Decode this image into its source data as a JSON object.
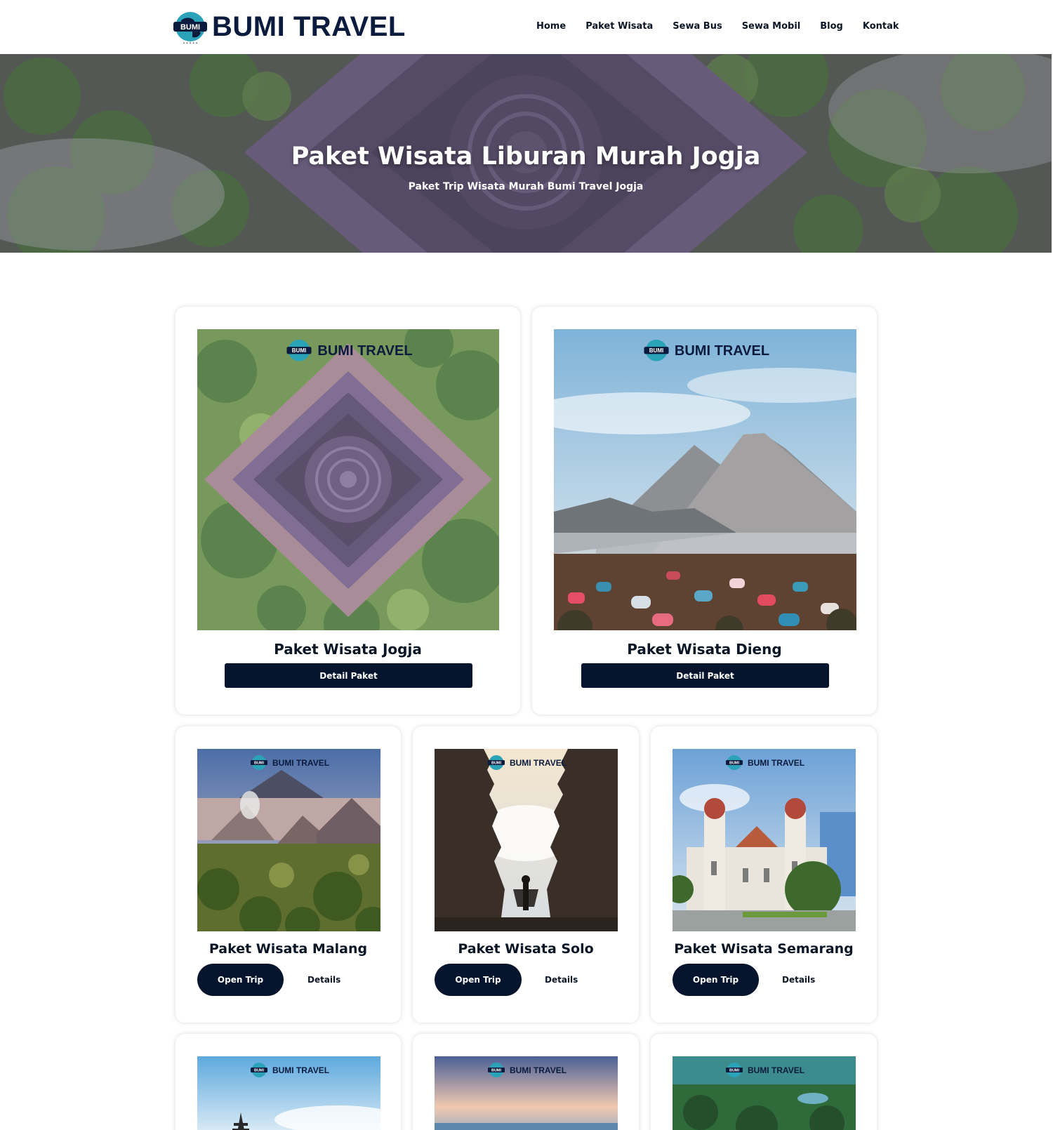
{
  "brand": {
    "name": "BUMI TRAVEL",
    "badge": "BUMI"
  },
  "nav": [
    "Home",
    "Paket Wisata",
    "Sewa Bus",
    "Sewa Mobil",
    "Blog",
    "Kontak"
  ],
  "hero": {
    "title": "Paket Wisata Liburan Murah Jogja",
    "subtitle": "Paket Trip Wisata Murah Bumi Travel Jogja"
  },
  "featured": [
    {
      "title": "Paket Wisata Jogja",
      "button": "Detail Paket"
    },
    {
      "title": "Paket Wisata Dieng",
      "button": "Detail Paket"
    }
  ],
  "packages": [
    {
      "title": "Paket Wisata Malang",
      "primary": "Open Trip",
      "secondary": "Details"
    },
    {
      "title": "Paket Wisata Solo",
      "primary": "Open Trip",
      "secondary": "Details"
    },
    {
      "title": "Paket Wisata Semarang",
      "primary": "Open Trip",
      "secondary": "Details"
    }
  ],
  "colors": {
    "navy": "#06152d",
    "brand": "#0a1b3d",
    "accent": "#2aa3b8"
  }
}
